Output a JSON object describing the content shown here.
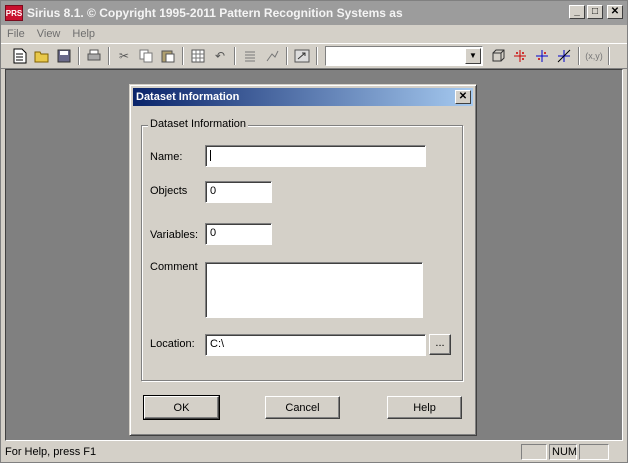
{
  "app": {
    "icon_text": "PRS",
    "title": "Sirius 8.1. © Copyright 1995-2011 Pattern Recognition Systems as",
    "window_controls": {
      "minimize": "_",
      "maximize": "□",
      "close": "✕"
    }
  },
  "menu": {
    "items": [
      "File",
      "View",
      "Help"
    ]
  },
  "toolbar": {
    "combo_value": "",
    "coord_label": "(x,y)"
  },
  "dialog": {
    "title": "Dataset Information",
    "close": "✕",
    "group_label": "Dataset Information",
    "fields": {
      "name_label": "Name:",
      "name_value": "",
      "objects_label": "Objects",
      "objects_value": "0",
      "variables_label": "Variables:",
      "variables_value": "0",
      "comment_label": "Comment",
      "comment_value": "",
      "location_label": "Location:",
      "location_value": "C:\\",
      "browse": "..."
    },
    "buttons": {
      "ok": "OK",
      "cancel": "Cancel",
      "help": "Help"
    }
  },
  "status": {
    "text": "For Help, press F1",
    "num": "NUM"
  }
}
